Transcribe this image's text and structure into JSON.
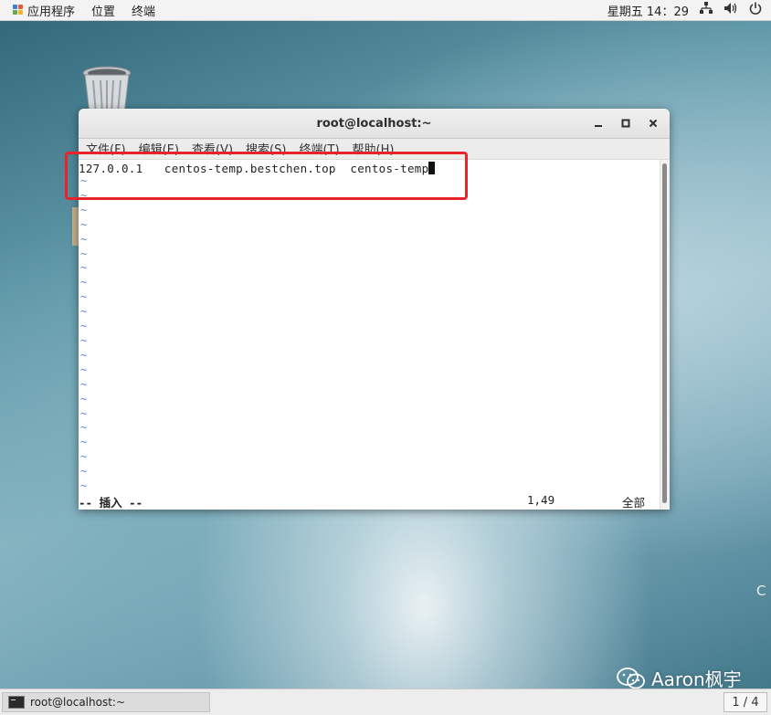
{
  "topbar": {
    "apps_label": "应用程序",
    "places_label": "位置",
    "terminal_label": "终端",
    "datetime": "星期五 14：29"
  },
  "window": {
    "title": "root@localhost:~",
    "menu": [
      "文件(F)",
      "编辑(E)",
      "查看(V)",
      "搜索(S)",
      "终端(T)",
      "帮助(H)"
    ],
    "content_line": "127.0.0.1   centos-temp.bestchen.top  centos-temp",
    "empty_line_marker": "~",
    "status_mode": "-- 插入 --",
    "status_position": "1,49",
    "status_scope": "全部"
  },
  "edge_char": "C",
  "watermark": "Aaron枫宇",
  "taskbar": {
    "task_label": "root@localhost:~",
    "pager": "1 / 4"
  },
  "colors": {
    "highlight": "#e8242a",
    "tilde": "#5a84d6"
  }
}
